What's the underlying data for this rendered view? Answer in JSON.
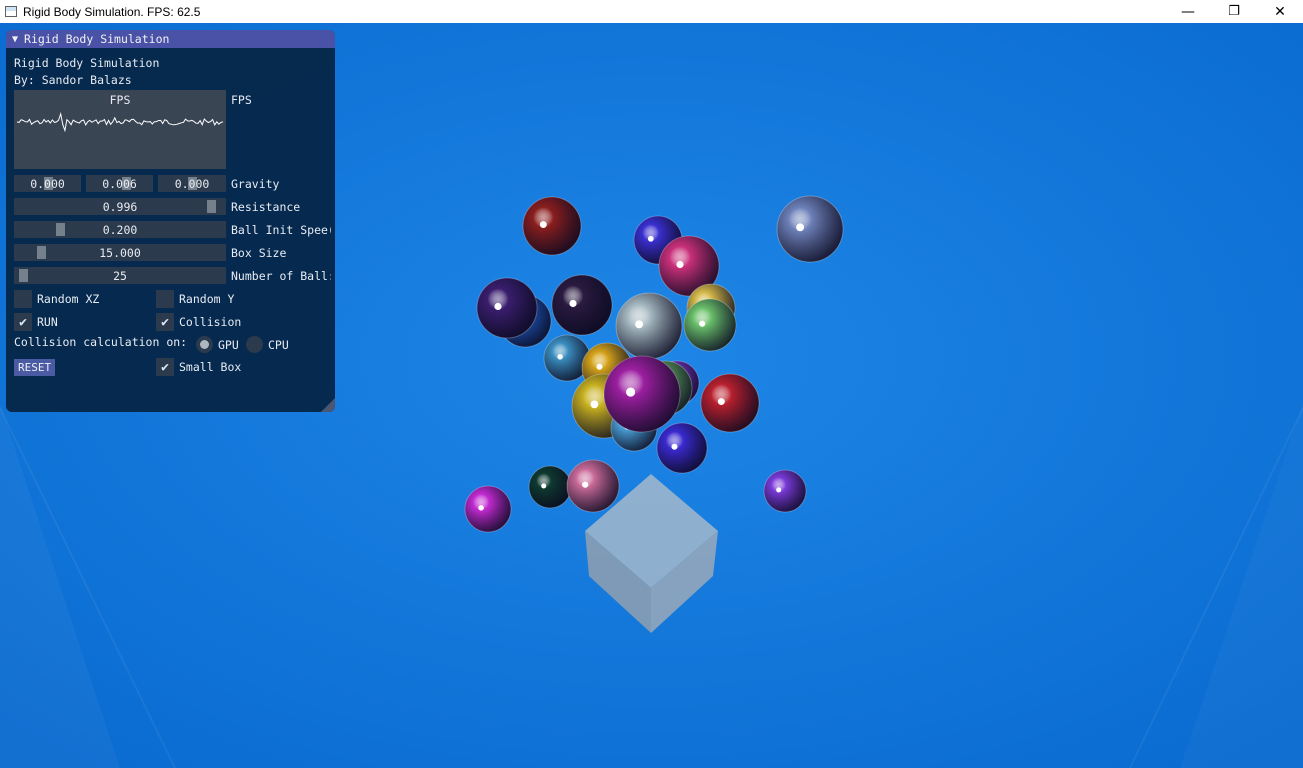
{
  "window": {
    "title": "Rigid Body Simulation. FPS: 62.5",
    "minimize_glyph": "—",
    "restore_glyph": "❐",
    "close_glyph": "✕"
  },
  "panel": {
    "header_arrow": "▼",
    "header_title": "Rigid Body Simulation",
    "line1": "Rigid Body Simulation",
    "line2": "By: Sandor Balazs",
    "plot_title": "FPS",
    "plot_label": "FPS",
    "gravity": {
      "x": "0.000",
      "y": "0.006",
      "z": "0.000",
      "label": "Gravity"
    },
    "resistance": {
      "value": "0.996",
      "label": "Resistance"
    },
    "init_speed": {
      "value": "0.200",
      "label": "Ball Init Spee("
    },
    "box_size": {
      "value": "15.000",
      "label": "Box Size"
    },
    "num_balls": {
      "value": "25",
      "label": "Number of Ball:"
    },
    "random_xz": {
      "label": "Random XZ",
      "checked": false
    },
    "random_y": {
      "label": "Random Y",
      "checked": false
    },
    "run": {
      "label": "RUN",
      "checked": true
    },
    "collision": {
      "label": "Collision",
      "checked": true
    },
    "collision_calc_label": "Collision calculation on:",
    "gpu_label": "GPU",
    "cpu_label": "CPU",
    "selected_device": "GPU",
    "reset_label": "RESET",
    "small_box": {
      "label": "Small Box",
      "checked": true
    },
    "check_glyph": "✔"
  },
  "colors": {
    "background": "#0f74d6",
    "panel_bg": "#052344",
    "header_bg": "#4a52a8",
    "frame_bg": "#2b3a4c",
    "button_bg": "#4a5aa3"
  },
  "scene": {
    "balls": [
      {
        "color": "#8a1e1e"
      },
      {
        "color": "#3a2fd0"
      },
      {
        "color": "#c9307a"
      },
      {
        "color": "#6d80b8"
      },
      {
        "color": "#1d58c0"
      },
      {
        "color": "#3a1e6e"
      },
      {
        "color": "#2a1a40"
      },
      {
        "color": "#a5b8c0"
      },
      {
        "color": "#d4b84a"
      },
      {
        "color": "#6abf6a"
      },
      {
        "color": "#3b8ec0"
      },
      {
        "color": "#d4a21a"
      },
      {
        "color": "#7a35c8"
      },
      {
        "color": "#5ea35e"
      },
      {
        "color": "#c7b020"
      },
      {
        "color": "#4aa0d8"
      },
      {
        "color": "#9c1fa0"
      },
      {
        "color": "#b8202e"
      },
      {
        "color": "#3a2ad0"
      },
      {
        "color": "#0e3a30"
      },
      {
        "color": "#c86a98"
      },
      {
        "color": "#c12ad0"
      },
      {
        "color": "#7a3ad8"
      },
      {
        "color": "#2a5ad0"
      },
      {
        "color": "#d6a000"
      }
    ]
  }
}
